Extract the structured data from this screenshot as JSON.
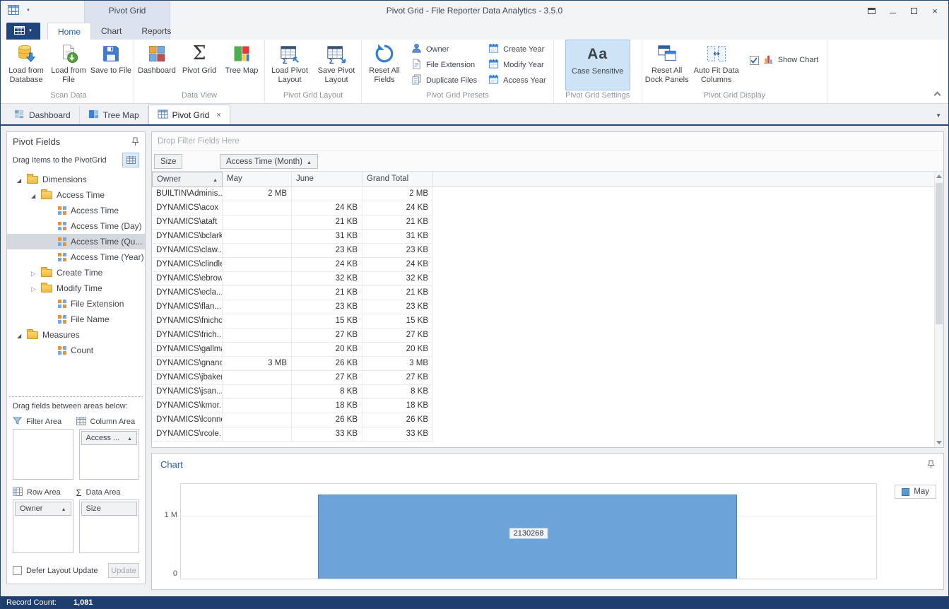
{
  "colors": {
    "accent_blue": "#2b5fa6",
    "selection_blue": "#cfe3f7",
    "chart_bar_blue": "#6ca3d8",
    "statusbar_bg": "#1e3e6f"
  },
  "titlebar": {
    "category": "Pivot Grid",
    "title": "Pivot Grid - File Reporter Data Analytics - 3.5.0"
  },
  "ribbon": {
    "tab_home": "Home",
    "tab_chart": "Chart",
    "tab_reports": "Reports",
    "groups": {
      "scan_data": {
        "label": "Scan Data",
        "load_from_database": "Load from Database",
        "load_from_file": "Load from File",
        "save_to_file": "Save to File"
      },
      "data_view": {
        "label": "Data View",
        "dashboard": "Dashboard",
        "pivot_grid": "Pivot Grid",
        "tree_map": "Tree Map"
      },
      "pivot_grid_layout": {
        "label": "Pivot Grid Layout",
        "load_pivot_layout": "Load Pivot Layout",
        "save_pivot_layout": "Save Pivot Layout"
      },
      "pivot_grid_presets": {
        "label": "Pivot Grid Presets",
        "reset_all_fields": "Reset All Fields",
        "owner": "Owner",
        "file_extension": "File Extension",
        "duplicate_files": "Duplicate Files",
        "create_year": "Create Year",
        "modify_year": "Modify Year",
        "access_year": "Access Year"
      },
      "pivot_grid_settings": {
        "label": "Pivot Grid Settings",
        "case_sensitive": "Case Sensitive",
        "case_icon_text": "Aa"
      },
      "pivot_grid_display": {
        "label": "Pivot Grid Display",
        "reset_all_dock_panels": "Reset All Dock Panels",
        "auto_fit_data_columns": "Auto Fit Data Columns",
        "show_chart": "Show Chart",
        "show_chart_checked": true
      }
    }
  },
  "doc_tabs": {
    "dashboard": "Dashboard",
    "tree_map": "Tree Map",
    "pivot_grid": "Pivot Grid"
  },
  "fields_panel": {
    "title": "Pivot Fields",
    "drag_hint": "Drag Items to the PivotGrid",
    "tree": [
      {
        "label": "Dimensions",
        "cls": "ti i0 folder open"
      },
      {
        "label": "Access Time",
        "cls": "ti i1 folder open"
      },
      {
        "label": "Access Time",
        "cls": "ti leaf"
      },
      {
        "label": "Access Time (Day)",
        "cls": "ti leaf"
      },
      {
        "label": "Access Time (Qu...",
        "cls": "ti leaf sel"
      },
      {
        "label": "Access Time (Year)",
        "cls": "ti leaf"
      },
      {
        "label": "Create Time",
        "cls": "ti i1 folder closed"
      },
      {
        "label": "Modify Time",
        "cls": "ti i1 folder closed"
      },
      {
        "label": "File Extension",
        "cls": "ti leaf"
      },
      {
        "label": "File Name",
        "cls": "ti leaf"
      },
      {
        "label": "Measures",
        "cls": "ti i0 folder open"
      },
      {
        "label": "Count",
        "cls": "ti leaf"
      }
    ],
    "areas_hint": "Drag fields between areas below:",
    "filter_area_label": "Filter Area",
    "column_area_label": "Column Area",
    "row_area_label": "Row Area",
    "data_area_label": "Data Area",
    "column_area_field": "Access ...",
    "row_area_field": "Owner",
    "data_area_field": "Size",
    "defer_label": "Defer Layout Update",
    "defer_checked": false,
    "update_button": "Update",
    "update_enabled": false
  },
  "pivot": {
    "drop_filter_hint": "Drop Filter Fields Here",
    "data_field_button": "Size",
    "column_field_button": "Access Time (Month)",
    "row_header": "Owner",
    "col_may": "May",
    "col_june": "June",
    "col_grand_total": "Grand Total",
    "rows": [
      {
        "owner": "BUILTIN\\Adminis...",
        "may": "2 MB",
        "june": "",
        "total": "2 MB"
      },
      {
        "owner": "DYNAMICS\\acox",
        "may": "",
        "june": "24 KB",
        "total": "24 KB"
      },
      {
        "owner": "DYNAMICS\\ataft",
        "may": "",
        "june": "21 KB",
        "total": "21 KB"
      },
      {
        "owner": "DYNAMICS\\bclark",
        "may": "",
        "june": "31 KB",
        "total": "31 KB"
      },
      {
        "owner": "DYNAMICS\\claw...",
        "may": "",
        "june": "23 KB",
        "total": "23 KB"
      },
      {
        "owner": "DYNAMICS\\clindley",
        "may": "",
        "june": "24 KB",
        "total": "24 KB"
      },
      {
        "owner": "DYNAMICS\\ebrown",
        "may": "",
        "june": "32 KB",
        "total": "32 KB"
      },
      {
        "owner": "DYNAMICS\\ecla...",
        "may": "",
        "june": "21 KB",
        "total": "21 KB"
      },
      {
        "owner": "DYNAMICS\\flan...",
        "may": "",
        "june": "23 KB",
        "total": "23 KB"
      },
      {
        "owner": "DYNAMICS\\fnichols",
        "may": "",
        "june": "15 KB",
        "total": "15 KB"
      },
      {
        "owner": "DYNAMICS\\frich...",
        "may": "",
        "june": "27 KB",
        "total": "27 KB"
      },
      {
        "owner": "DYNAMICS\\gallman",
        "may": "",
        "june": "20 KB",
        "total": "20 KB"
      },
      {
        "owner": "DYNAMICS\\gnance",
        "may": "3 MB",
        "june": "26 KB",
        "total": "3 MB"
      },
      {
        "owner": "DYNAMICS\\jbaker",
        "may": "",
        "june": "27 KB",
        "total": "27 KB"
      },
      {
        "owner": "DYNAMICS\\jsan...",
        "may": "",
        "june": "8 KB",
        "total": "8 KB"
      },
      {
        "owner": "DYNAMICS\\kmor...",
        "may": "",
        "june": "18 KB",
        "total": "18 KB"
      },
      {
        "owner": "DYNAMICS\\lconner",
        "may": "",
        "june": "26 KB",
        "total": "26 KB"
      },
      {
        "owner": "DYNAMICS\\rcole...",
        "may": "",
        "june": "33 KB",
        "total": "33 KB"
      }
    ]
  },
  "chart_panel": {
    "title": "Chart",
    "legend_may": "May",
    "ytick_1m": "1 M",
    "ytick_0": "0",
    "bar_value_label": "2130268"
  },
  "chart_data": {
    "type": "bar",
    "title": "Chart",
    "categories": [
      ""
    ],
    "series": [
      {
        "name": "May",
        "values": [
          2130268
        ]
      }
    ],
    "ylabel": "",
    "ylim": [
      0,
      2400000
    ],
    "ytick_labels": [
      "0",
      "1 M"
    ],
    "legend_position": "top-right",
    "grid": true
  },
  "statusbar": {
    "record_count_label": "Record Count:",
    "record_count_value": "1,081"
  }
}
